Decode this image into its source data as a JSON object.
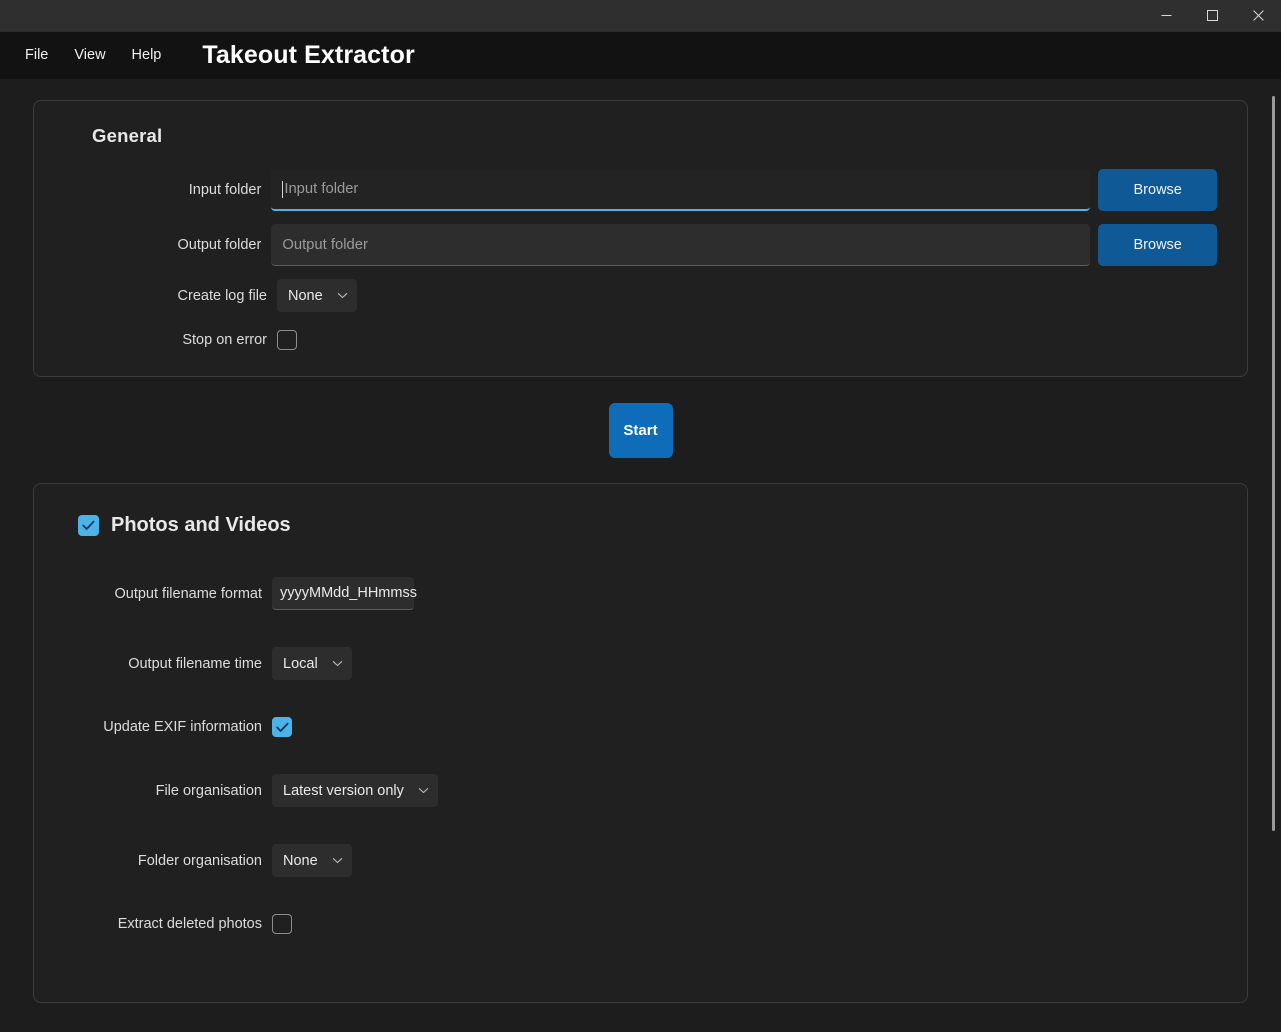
{
  "window": {
    "controls": [
      {
        "name": "minimize",
        "glyph": "minimize-icon"
      },
      {
        "name": "maximize",
        "glyph": "maximize-icon"
      },
      {
        "name": "close",
        "glyph": "close-icon"
      }
    ]
  },
  "menubar": {
    "items": [
      "File",
      "View",
      "Help"
    ],
    "app_title": "Takeout Extractor"
  },
  "general": {
    "title": "General",
    "input_folder": {
      "label": "Input folder",
      "value": "",
      "placeholder": "Input folder",
      "focused": true,
      "browse_label": "Browse"
    },
    "output_folder": {
      "label": "Output folder",
      "value": "",
      "placeholder": "Output folder",
      "focused": false,
      "browse_label": "Browse"
    },
    "create_log_file": {
      "label": "Create log file",
      "selected": "None"
    },
    "stop_on_error": {
      "label": "Stop on error",
      "checked": false
    }
  },
  "start_button": {
    "label": "Start"
  },
  "photos": {
    "title": "Photos and Videos",
    "enabled": true,
    "output_filename_format": {
      "label": "Output filename format",
      "value": "yyyyMMdd_HHmmss"
    },
    "output_filename_time": {
      "label": "Output filename time",
      "selected": "Local"
    },
    "update_exif": {
      "label": "Update EXIF information",
      "checked": true
    },
    "file_organisation": {
      "label": "File organisation",
      "selected": "Latest version only"
    },
    "folder_organisation": {
      "label": "Folder organisation",
      "selected": "None"
    },
    "extract_deleted_photos": {
      "label": "Extract deleted photos",
      "checked": false
    }
  },
  "colors": {
    "page_background": "#1d1d1d",
    "panel_background": "#202020",
    "panel_border": "#3b3b3b",
    "menubar_background": "#121212",
    "titlebar_background": "#2f2f2f",
    "accent_blue": "#4cb3e8",
    "browse_button": "#0f5a96",
    "start_button": "#0e6cb8",
    "field_background": "#2d2d2d"
  }
}
